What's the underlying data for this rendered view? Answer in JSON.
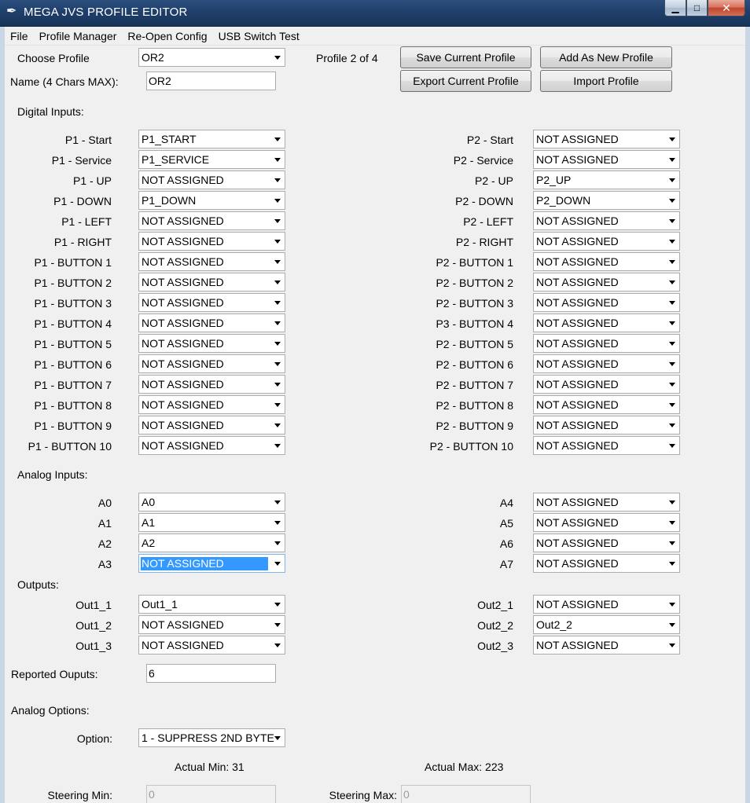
{
  "window": {
    "title": "MEGA JVS PROFILE EDITOR",
    "icon": "feather-icon"
  },
  "menu": [
    "File",
    "Profile Manager",
    "Re-Open Config",
    "USB Switch Test"
  ],
  "profile": {
    "choose_label": "Choose Profile",
    "selected": "OR2",
    "counter": "Profile 2 of 4",
    "name_label": "Name (4 Chars MAX):",
    "name_value": "OR2"
  },
  "buttons": {
    "save": "Save Current Profile",
    "add": "Add As New Profile",
    "export": "Export Current Profile",
    "import": "Import Profile"
  },
  "digital": {
    "heading": "Digital Inputs:",
    "p1": [
      {
        "label": "P1 - Start",
        "value": "P1_START"
      },
      {
        "label": "P1 - Service",
        "value": "P1_SERVICE"
      },
      {
        "label": "P1 - UP",
        "value": "NOT ASSIGNED"
      },
      {
        "label": "P1 - DOWN",
        "value": "P1_DOWN"
      },
      {
        "label": "P1 - LEFT",
        "value": "NOT ASSIGNED"
      },
      {
        "label": "P1 - RIGHT",
        "value": "NOT ASSIGNED"
      },
      {
        "label": "P1 - BUTTON 1",
        "value": "NOT ASSIGNED"
      },
      {
        "label": "P1 - BUTTON 2",
        "value": "NOT ASSIGNED"
      },
      {
        "label": "P1 - BUTTON 3",
        "value": "NOT ASSIGNED"
      },
      {
        "label": "P1 - BUTTON 4",
        "value": "NOT ASSIGNED"
      },
      {
        "label": "P1 - BUTTON 5",
        "value": "NOT ASSIGNED"
      },
      {
        "label": "P1 - BUTTON 6",
        "value": "NOT ASSIGNED"
      },
      {
        "label": "P1 - BUTTON 7",
        "value": "NOT ASSIGNED"
      },
      {
        "label": "P1 - BUTTON 8",
        "value": "NOT ASSIGNED"
      },
      {
        "label": "P1 - BUTTON 9",
        "value": "NOT ASSIGNED"
      },
      {
        "label": "P1 - BUTTON 10",
        "value": "NOT ASSIGNED"
      }
    ],
    "p2": [
      {
        "label": "P2 - Start",
        "value": "NOT ASSIGNED"
      },
      {
        "label": "P2 - Service",
        "value": "NOT ASSIGNED"
      },
      {
        "label": "P2 - UP",
        "value": "P2_UP"
      },
      {
        "label": "P2 - DOWN",
        "value": "P2_DOWN"
      },
      {
        "label": "P2 - LEFT",
        "value": "NOT ASSIGNED"
      },
      {
        "label": "P2 - RIGHT",
        "value": "NOT ASSIGNED"
      },
      {
        "label": "P2 - BUTTON 1",
        "value": "NOT ASSIGNED"
      },
      {
        "label": "P2 - BUTTON 2",
        "value": "NOT ASSIGNED"
      },
      {
        "label": "P2 - BUTTON 3",
        "value": "NOT ASSIGNED"
      },
      {
        "label": "P3 - BUTTON 4",
        "value": "NOT ASSIGNED"
      },
      {
        "label": "P2 - BUTTON 5",
        "value": "NOT ASSIGNED"
      },
      {
        "label": "P2 - BUTTON 6",
        "value": "NOT ASSIGNED"
      },
      {
        "label": "P2 - BUTTON 7",
        "value": "NOT ASSIGNED"
      },
      {
        "label": "P2 - BUTTON 8",
        "value": "NOT ASSIGNED"
      },
      {
        "label": "P2 - BUTTON 9",
        "value": "NOT ASSIGNED"
      },
      {
        "label": "P2 - BUTTON 10",
        "value": "NOT ASSIGNED"
      }
    ]
  },
  "analog": {
    "heading": "Analog Inputs:",
    "left": [
      {
        "label": "A0",
        "value": "A0"
      },
      {
        "label": "A1",
        "value": "A1"
      },
      {
        "label": "A2",
        "value": "A2"
      },
      {
        "label": "A3",
        "value": "NOT ASSIGNED",
        "selected": true
      }
    ],
    "right": [
      {
        "label": "A4",
        "value": "NOT ASSIGNED"
      },
      {
        "label": "A5",
        "value": "NOT ASSIGNED"
      },
      {
        "label": "A6",
        "value": "NOT ASSIGNED"
      },
      {
        "label": "A7",
        "value": "NOT ASSIGNED"
      }
    ]
  },
  "outputs": {
    "heading": "Outputs:",
    "left": [
      {
        "label": "Out1_1",
        "value": "Out1_1"
      },
      {
        "label": "Out1_2",
        "value": "NOT ASSIGNED"
      },
      {
        "label": "Out1_3",
        "value": "NOT ASSIGNED"
      }
    ],
    "right": [
      {
        "label": "Out2_1",
        "value": "NOT ASSIGNED"
      },
      {
        "label": "Out2_2",
        "value": "Out2_2"
      },
      {
        "label": "Out2_3",
        "value": "NOT ASSIGNED"
      }
    ]
  },
  "reported": {
    "label": "Reported Ouputs:",
    "value": "6"
  },
  "analog_options": {
    "heading": "Analog Options:",
    "option_label": "Option:",
    "option_value": "1 - SUPPRESS 2ND BYTE",
    "actual_min": "Actual Min: 31",
    "actual_max": "Actual Max: 223",
    "steering_min_label": "Steering Min:",
    "steering_min_value": "0",
    "steering_max_label": "Steering Max:",
    "steering_max_value": "0"
  }
}
